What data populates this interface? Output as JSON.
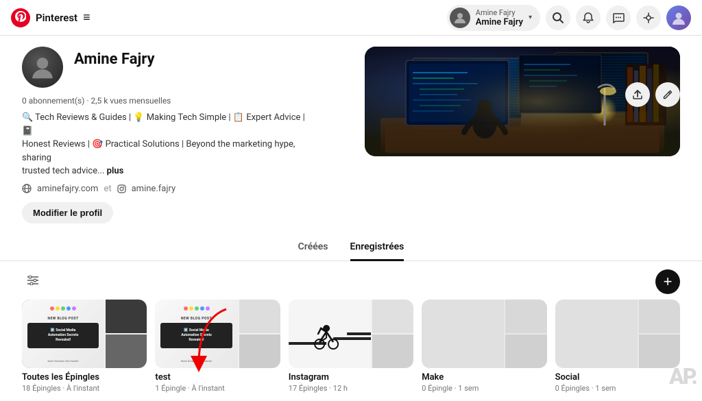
{
  "app": {
    "name": "Pinterest"
  },
  "nav": {
    "brand": "Pinterest",
    "hamburger": "≡",
    "user_name_small": "Amine Fajry",
    "user_name_big": "Amine Fajry",
    "chevron": "▾",
    "search_title": "Recherche",
    "notif_title": "Notifications",
    "messages_title": "Messages",
    "updates_title": "Mises à jour"
  },
  "profile": {
    "name": "Amine Fajry",
    "stats": "0 abonnement(s) · 2,5 k vues mensuelles",
    "bio_line1": "🔍 Tech Reviews & Guides | 💡 Making Tech Simple | 📋 Expert Advice | 📓",
    "bio_line2": "Honest Reviews | 🎯 Practical Solutions | Beyond the marketing hype, sharing",
    "bio_line3": "trusted tech advice...",
    "bio_plus": "plus",
    "website": "aminefajry.com",
    "website_sep": "et",
    "instagram": "amine.fajry",
    "modify_label": "Modifier le profil",
    "share_icon": "↑",
    "edit_icon": "✏"
  },
  "tabs": [
    {
      "id": "creees",
      "label": "Créées",
      "active": false
    },
    {
      "id": "enregistrees",
      "label": "Enregistrées",
      "active": true
    }
  ],
  "boards_toolbar": {
    "filter_icon": "⚙",
    "add_icon": "+"
  },
  "boards": [
    {
      "id": "toutes",
      "title": "Toutes les Épingles",
      "count": "18 Épingles",
      "time": "À l'instant",
      "has_composite": true
    },
    {
      "id": "test",
      "title": "test",
      "count": "1 Épingle",
      "time": "À l'instant",
      "has_composite": true
    },
    {
      "id": "instagram",
      "title": "Instagram",
      "count": "17 Épingles",
      "time": "12 h",
      "has_composite": true
    },
    {
      "id": "make",
      "title": "Make",
      "count": "0 Épingle",
      "time": "1 sem",
      "has_composite": false
    },
    {
      "id": "social",
      "title": "Social",
      "count": "0 Épingles",
      "time": "1 sem",
      "has_composite": false
    }
  ]
}
